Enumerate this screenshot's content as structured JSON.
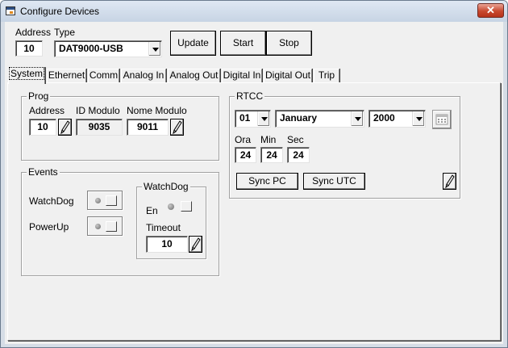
{
  "window": {
    "title": "Configure Devices"
  },
  "top": {
    "address_label": "Address",
    "address_value": "10",
    "type_label": "Type",
    "type_value": "DAT9000-USB",
    "update_label": "Update",
    "start_label": "Start",
    "stop_label": "Stop"
  },
  "tabs": [
    {
      "label": "System"
    },
    {
      "label": "Ethernet"
    },
    {
      "label": "Comm"
    },
    {
      "label": "Analog In"
    },
    {
      "label": "Analog Out"
    },
    {
      "label": "Digital In"
    },
    {
      "label": "Digital Out"
    },
    {
      "label": "Trip"
    }
  ],
  "prog": {
    "title": "Prog",
    "address_label": "Address",
    "address_value": "10",
    "id_label": "ID Modulo",
    "id_value": "9035",
    "name_label": "Nome Modulo",
    "name_value": "9011"
  },
  "events": {
    "title": "Events",
    "watchdog_label": "WatchDog",
    "powerup_label": "PowerUp",
    "wd_group_title": "WatchDog",
    "en_label": "En",
    "timeout_label": "Timeout",
    "timeout_value": "10"
  },
  "rtcc": {
    "title": "RTCC",
    "day_value": "01",
    "month_value": "January",
    "year_value": "2000",
    "ora_label": "Ora",
    "min_label": "Min",
    "sec_label": "Sec",
    "ora_value": "24",
    "min_value": "24",
    "sec_value": "24",
    "sync_pc_label": "Sync PC",
    "sync_utc_label": "Sync UTC"
  },
  "icons": {
    "close": "close-icon",
    "pencil": "pencil-icon",
    "calendar": "calendar-icon"
  }
}
